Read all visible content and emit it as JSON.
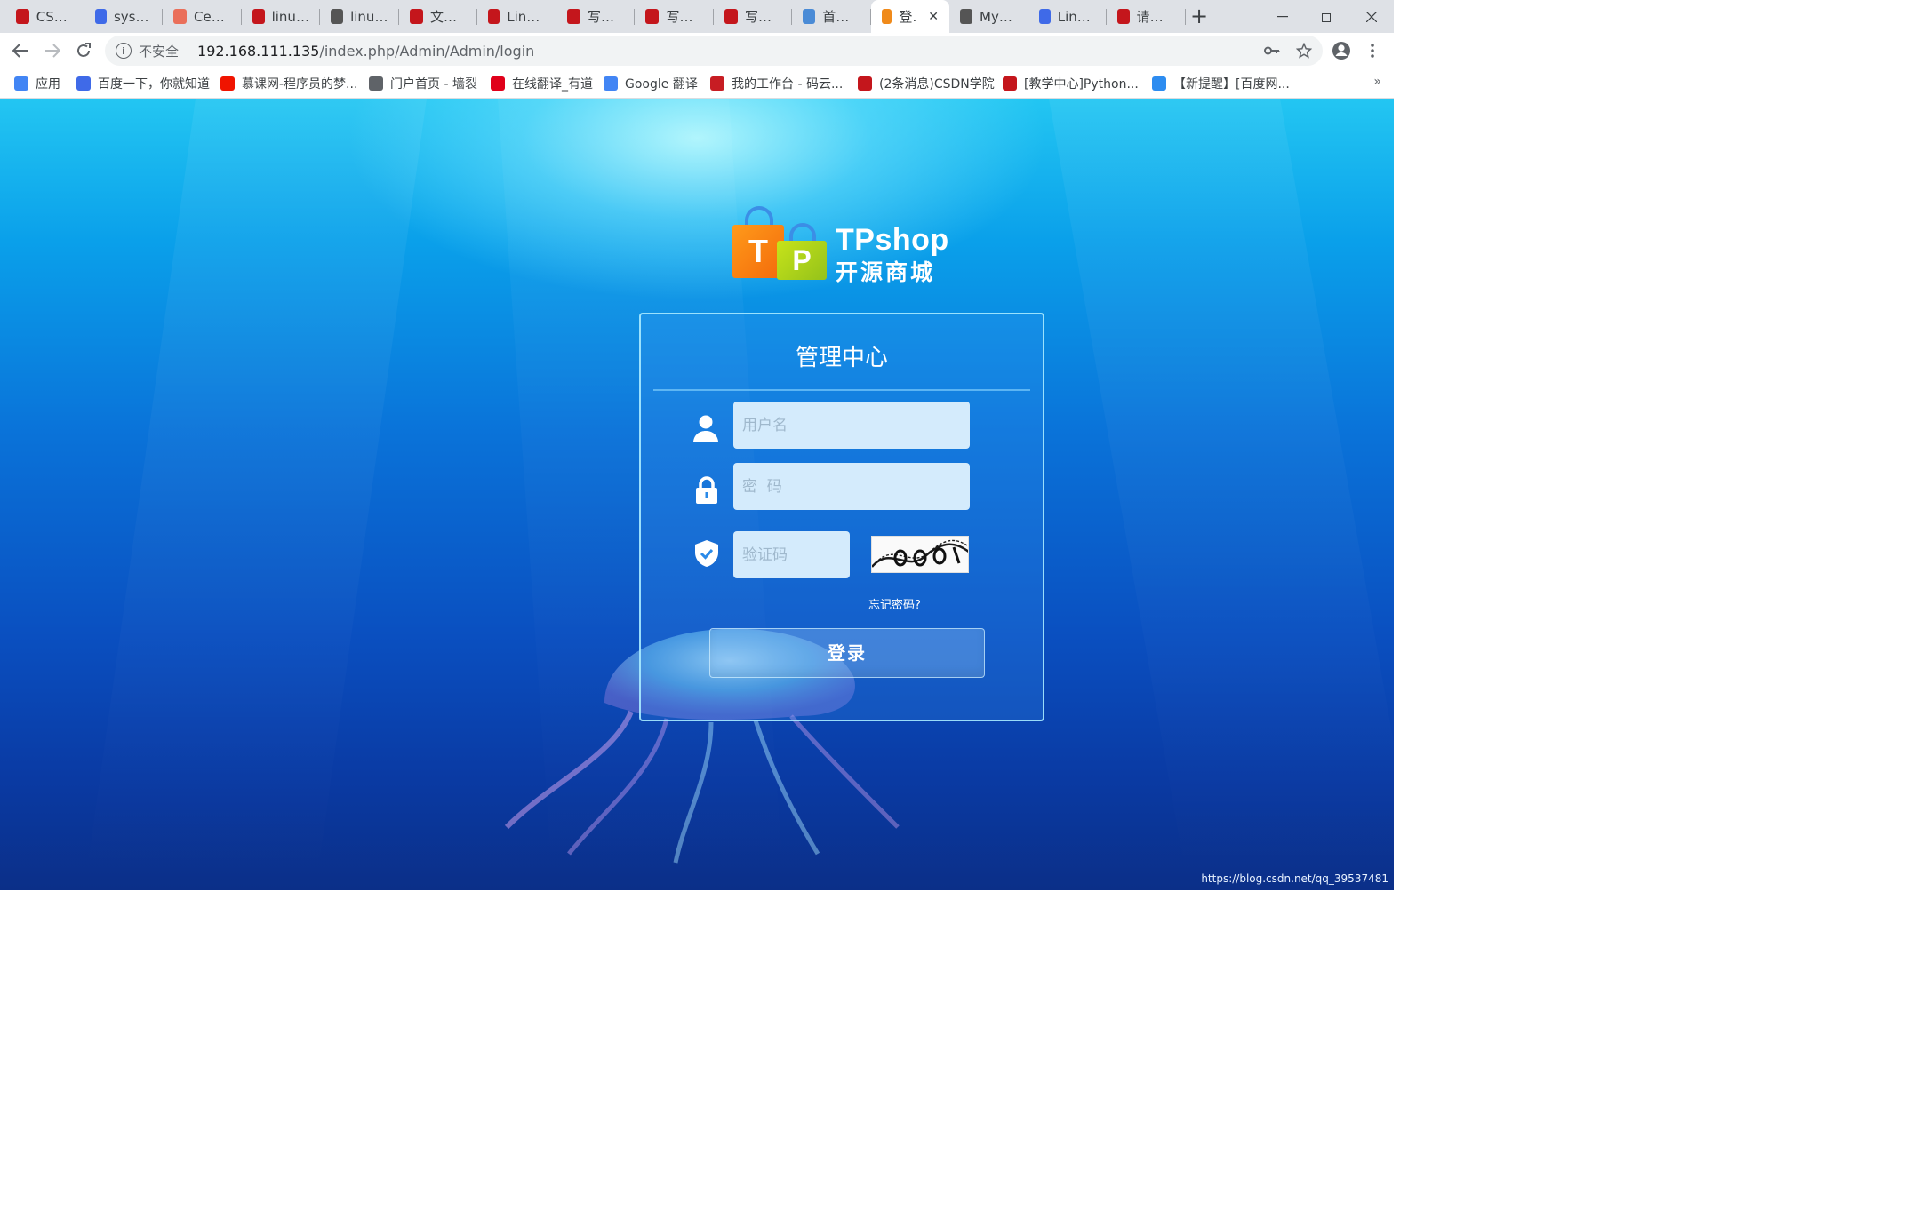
{
  "browser": {
    "tabs": [
      {
        "title": "CSDN-",
        "icon": "csdn-icon",
        "color": "#c4161c"
      },
      {
        "title": "system",
        "icon": "baidu-icon",
        "color": "#3f6ae8"
      },
      {
        "title": "CentO",
        "icon": "jianshu-icon",
        "color": "#ea6f5a"
      },
      {
        "title": "linux中",
        "icon": "csdn-icon",
        "color": "#c4161c"
      },
      {
        "title": "linux查",
        "icon": "generic-icon",
        "color": "#555555"
      },
      {
        "title": "文章管",
        "icon": "csdn-icon",
        "color": "#c4161c"
      },
      {
        "title": "Linux环",
        "icon": "csdn-icon",
        "color": "#c4161c"
      },
      {
        "title": "写文章",
        "icon": "csdn-icon",
        "color": "#c4161c"
      },
      {
        "title": "写文章",
        "icon": "csdn-icon",
        "color": "#c4161c"
      },
      {
        "title": "写文章",
        "icon": "csdn-icon",
        "color": "#c4161c"
      },
      {
        "title": "首页-开",
        "icon": "site-icon",
        "color": "#4a8bd6"
      },
      {
        "title": "登录",
        "icon": "tpshop-icon",
        "color": "#f08a1a",
        "active": true
      },
      {
        "title": "MySQL",
        "icon": "generic-icon",
        "color": "#555555"
      },
      {
        "title": "Linux服",
        "icon": "baidu-icon",
        "color": "#3f6ae8"
      },
      {
        "title": "请在my",
        "icon": "csdn-icon",
        "color": "#c4161c"
      }
    ],
    "new_tab": "+",
    "window": {
      "minimize": "—",
      "restore": "❐",
      "close": "✕"
    },
    "toolbar": {
      "insecure_label": "不安全",
      "url_host": "192.168.111.135",
      "url_path": "/index.php/Admin/Admin/login"
    },
    "bookmarks": [
      {
        "label": "应用",
        "icon": "apps-icon",
        "color": "#4285f4"
      },
      {
        "label": "百度一下，你就知道",
        "icon": "baidu-icon",
        "color": "#3f6ae8"
      },
      {
        "label": "慕课网-程序员的梦...",
        "icon": "imooc-icon",
        "color": "#f01400"
      },
      {
        "label": "门户首页 - 墙裂",
        "icon": "globe-icon",
        "color": "#5f6368"
      },
      {
        "label": "在线翻译_有道",
        "icon": "youdao-icon",
        "color": "#e0001a"
      },
      {
        "label": "Google 翻译",
        "icon": "google-translate-icon",
        "color": "#4285f4"
      },
      {
        "label": "我的工作台 - 码云...",
        "icon": "gitee-icon",
        "color": "#c71d23"
      },
      {
        "label": "(2条消息)CSDN学院",
        "icon": "csdn-icon",
        "color": "#c4161c"
      },
      {
        "label": "[教学中心]Python...",
        "icon": "csdn-icon",
        "color": "#c4161c"
      },
      {
        "label": "【新提醒】[百度网...",
        "icon": "baidu-pan-icon",
        "color": "#2d8cf0"
      }
    ],
    "bookmarks_more": "»"
  },
  "login": {
    "logo": {
      "letters_t": "T",
      "letters_p": "P",
      "name": "TPshop",
      "tagline": "开源商城"
    },
    "title": "管理中心",
    "username_placeholder": "用户名",
    "password_placeholder": "密  码",
    "captcha_placeholder": "验证码",
    "forgot_password": "忘记密码?",
    "submit_label": "登录"
  },
  "watermark": "https://blog.csdn.net/qq_39537481"
}
